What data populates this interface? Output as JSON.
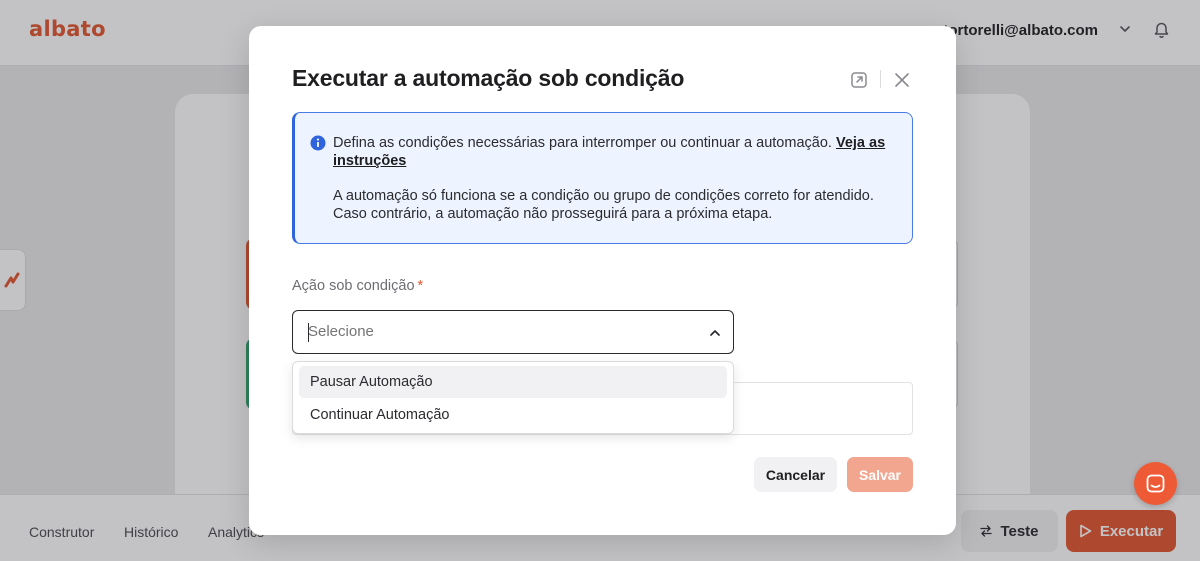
{
  "app": {
    "logo_text": "albato",
    "brand_color": "#e2552f",
    "user_email": "o.tortorelli@albato.com"
  },
  "bottom_tabs": [
    "Construtor",
    "Histórico",
    "Analytics"
  ],
  "actions": {
    "test_label": "Teste",
    "run_label": "Executar"
  },
  "modal": {
    "title": "Executar a automação sob condição",
    "info": {
      "text_before_link": "Defina as condições necessárias para interromper ou continuar a automação. ",
      "link_text": "Veja as instruções",
      "paragraph2": "A automação só funciona se a condição ou grupo de condições correto for atendido. Caso contrário, a automação não prosseguirá para a próxima etapa."
    },
    "field": {
      "label": "Ação sob condição",
      "required_mark": "*",
      "placeholder": "Selecione",
      "options": [
        "Pausar Automação",
        "Continuar Automação"
      ],
      "highlighted_option": "Pausar Automação"
    },
    "buttons": {
      "cancel": "Cancelar",
      "save": "Salvar"
    }
  },
  "icons": {
    "modal_action": "open-external-icon",
    "modal_close": "close-icon",
    "info": "info-icon",
    "chevron": "chevron-up-icon",
    "chat": "chat-icon",
    "bell": "bell-icon"
  }
}
